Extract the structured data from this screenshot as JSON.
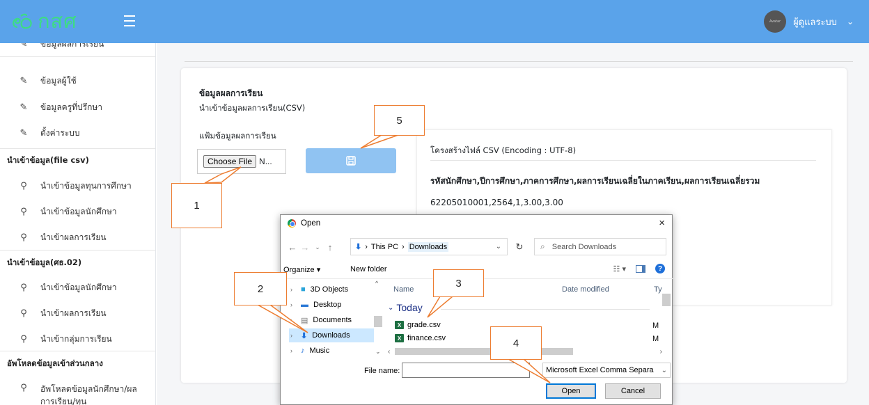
{
  "header": {
    "logo_text": "กสศ",
    "user_name": "ผู้ดูแลระบบ",
    "avatar_text": "Avatar",
    "user_dropdown_icon": "chevron-down-icon"
  },
  "sidebar": {
    "cut_item": "ข้อมูลผลการเรียน",
    "items_top": [
      {
        "label": "ข้อมูลผู้ใช้",
        "icon": "edit-icon"
      },
      {
        "label": "ข้อมูลครูที่ปรึกษา",
        "icon": "edit-icon"
      },
      {
        "label": "ตั้งค่าระบบ",
        "icon": "edit-icon"
      }
    ],
    "section_csv": {
      "title": "นำเข้าข้อมูล(file csv)",
      "items": [
        "นำเข้าข้อมูลทุนการศึกษา",
        "นำเข้าข้อมูลนักศึกษา",
        "นำเข้าผลการเรียน"
      ]
    },
    "section_ks02": {
      "title": "นำเข้าข้อมูล(ศธ.02)",
      "items": [
        "นำเข้าข้อมูลนักศึกษา",
        "นำเข้าผลการเรียน",
        "นำเข้ากลุ่มการเรียน"
      ]
    },
    "section_upload": {
      "title": "อัพโหลดข้อมูลเข้าส่วนกลาง",
      "item_line1": "อัพโหลดข้อมูลนักศึกษา/ผล",
      "item_line2": "การเรียน/ทุน"
    }
  },
  "card": {
    "title": "ข้อมูลผลการเรียน",
    "subtitle": "นำเข้าข้อมูลผลการเรียน(CSV)",
    "file_label": "แฟ้มข้อมูลผลการเรียน",
    "choose_file": "Choose File",
    "no_file": "N...",
    "save_icon": "floppy-disk-icon",
    "csv_heading": "โครงสร้างไฟล์ CSV (Encoding : UTF-8)",
    "csv_fields": "รหัสนักศึกษา,ปีการศึกษา,ภาคการศึกษา,ผลการเรียนเฉลี่ยในภาคเรียน,ผลการเรียนเฉลี่ยรวม",
    "csv_example": "62205010001,2564,1,3.00,3.00"
  },
  "dialog": {
    "title": "Open",
    "close": "×",
    "path": {
      "root": "This PC",
      "current": "Downloads"
    },
    "search_placeholder": "Search Downloads",
    "organize": "Organize ▾",
    "new_folder": "New folder",
    "nav_items": [
      "3D Objects",
      "Desktop",
      "Documents",
      "Downloads",
      "Music"
    ],
    "selected_nav": "Downloads",
    "columns": {
      "name": "Name",
      "date": "Date modified",
      "type": "Ty"
    },
    "group": "Today",
    "files": [
      {
        "name": "grade.csv",
        "type": "M"
      },
      {
        "name": "finance.csv",
        "type": "M"
      }
    ],
    "filename_label": "File name:",
    "filename_value": "",
    "filetype": "Microsoft Excel Comma Separa",
    "open_btn": "Open",
    "cancel_btn": "Cancel"
  },
  "callouts": [
    "1",
    "2",
    "3",
    "4",
    "5"
  ],
  "colors": {
    "topbar": "#5aa3ea",
    "logo": "#3ddc84",
    "save_button": "#90c3f2",
    "callout_border": "#ed7d31",
    "selection": "#cce8ff"
  }
}
